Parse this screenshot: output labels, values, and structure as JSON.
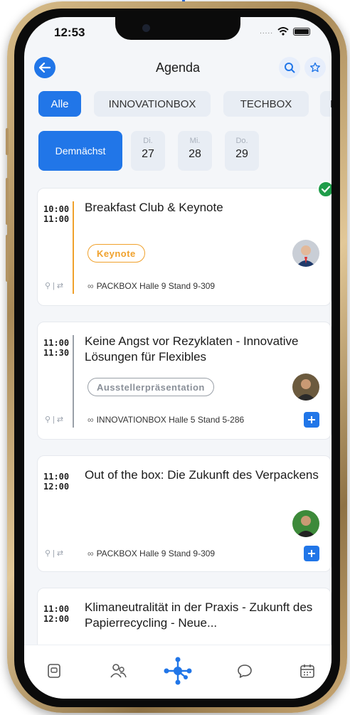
{
  "status": {
    "time": "12:53",
    "signal_dots": "....."
  },
  "header": {
    "title": "Agenda"
  },
  "categories": [
    "Alle",
    "INNOVATIONBOX",
    "TECHBOX",
    "PA"
  ],
  "dates": {
    "upcoming_label": "Demnächst",
    "days": [
      {
        "dow": "Di.",
        "day": "27"
      },
      {
        "dow": "Mi.",
        "day": "28"
      },
      {
        "dow": "Do.",
        "day": "29"
      }
    ]
  },
  "sessions": [
    {
      "start": "10:00",
      "end": "11:00",
      "title": "Breakfast Club & Keynote",
      "tag": "Keynote",
      "location": "PACKBOX Halle 9 Stand 9-309",
      "attended": true
    },
    {
      "start": "11:00",
      "end": "11:30",
      "title": "Keine Angst vor Rezyklaten - Innovative Lösungen für Flexibles",
      "tag": "Ausstellerpräsentation",
      "location": "INNOVATIONBOX Halle 5 Stand 5-286"
    },
    {
      "start": "11:00",
      "end": "12:00",
      "title": "Out of the box: Die Zukunft des Verpackens",
      "location": "PACKBOX Halle 9 Stand 9-309"
    },
    {
      "start": "11:00",
      "end": "12:00",
      "title": "Klimaneutralität in der Praxis - Zukunft des Papierrecycling - Neue..."
    }
  ],
  "icons": {
    "location": "pin-icon",
    "link": "link-icon",
    "tabs": [
      "card-icon",
      "people-icon",
      "network-icon",
      "chat-icon",
      "calendar-icon"
    ]
  },
  "colors": {
    "accent": "#2176e8",
    "keynote": "#f0a12c",
    "presentation": "#9aa0a8",
    "check": "#1f9d4a"
  }
}
